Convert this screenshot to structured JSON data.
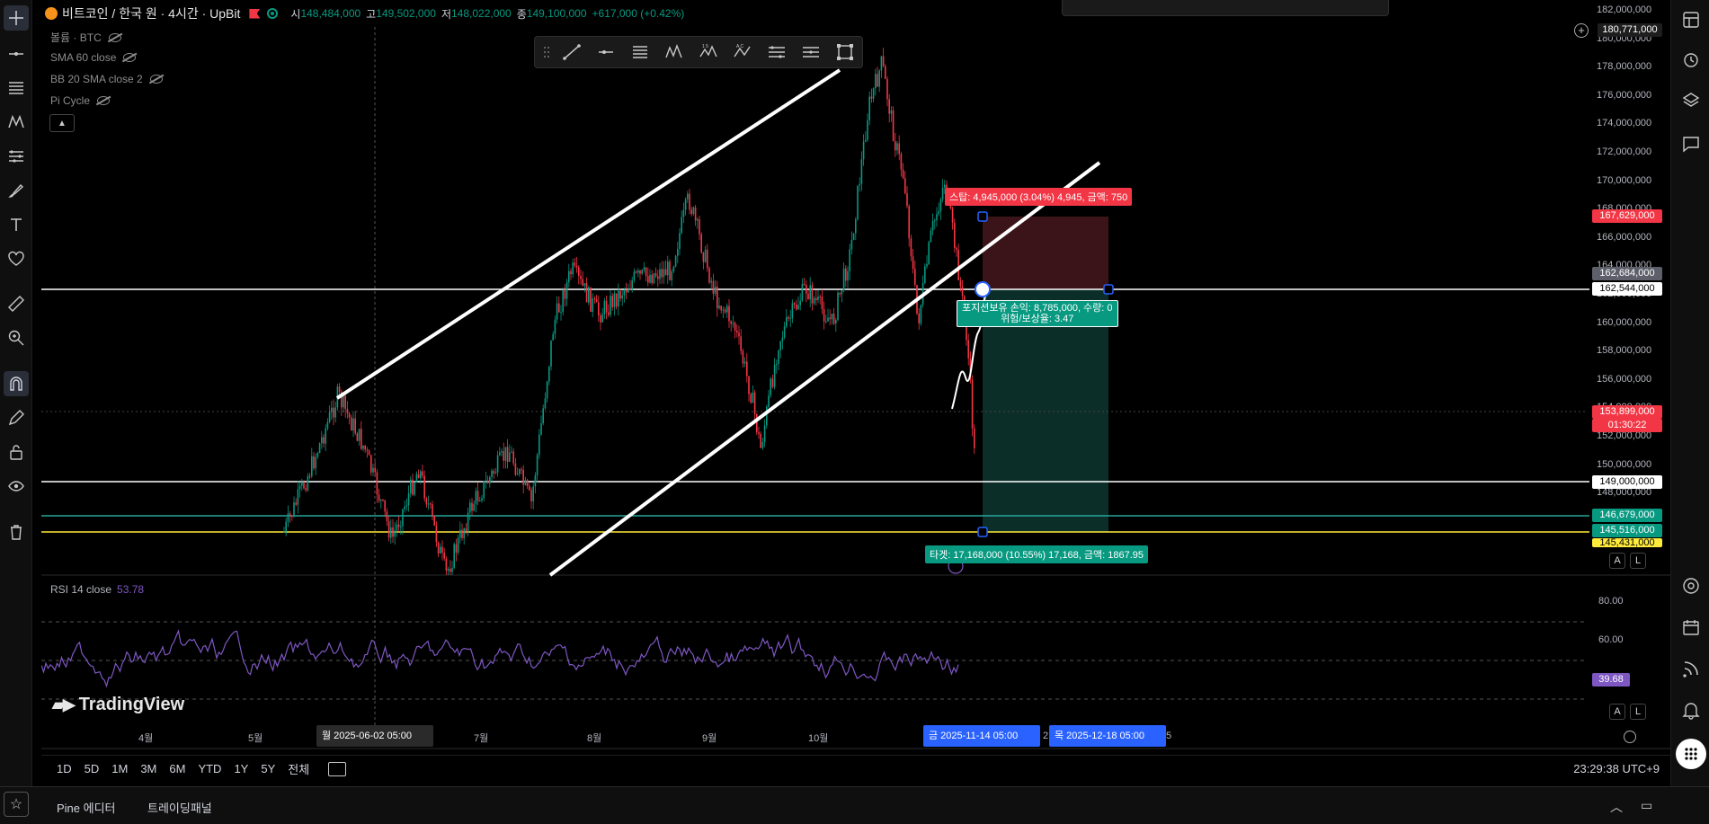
{
  "symbol": {
    "title": "비트코인 / 한국 원 · 4시간 · UpBit",
    "open_label": "시",
    "open": "148,484,000",
    "high_label": "고",
    "high": "149,502,000",
    "low_label": "저",
    "low": "148,022,000",
    "close_label": "종",
    "close": "149,100,000",
    "change": "+617,000 (+0.42%)"
  },
  "indicators": {
    "volume": "볼륨 · BTC",
    "sma": "SMA 60 close",
    "bb": "BB 20 SMA close 2",
    "pi": "Pi Cycle"
  },
  "price_axis": {
    "ticks": [
      "182,000,000",
      "180,000,000",
      "178,000,000",
      "176,000,000",
      "174,000,000",
      "172,000,000",
      "170,000,000",
      "168,000,000",
      "166,000,000",
      "164,000,000",
      "162,000,000",
      "160,000,000",
      "158,000,000",
      "156,000,000",
      "154,000,000",
      "152,000,000",
      "150,000,000",
      "148,000,000"
    ],
    "crosshair_price": "180,771,000",
    "stop_price": "167,629,000",
    "entry_upper": "162,684,000",
    "entry_price": "162,544,000",
    "last_price": "153,899,000",
    "countdown": "01:30:22",
    "h_line_1": "149,000,000",
    "h_line_2": "146,679,000",
    "h_line_3": "145,516,000",
    "h_line_4": "145,431,000"
  },
  "position_tool": {
    "stop_label": "스탑: 4,945,000 (3.04%) 4,945, 금액: 750",
    "info_line1": "포지션보유 손익: 8,785,000, 수량: 0",
    "info_line2": "위험/보상율: 3.47",
    "target_label": "타겟: 17,168,000 (10.55%) 17,168, 금액: 1867.95"
  },
  "rsi": {
    "title": "RSI 14 close",
    "value": "53.78",
    "ticks": [
      "80.00",
      "60.00"
    ],
    "current_badge": "39.68"
  },
  "time_axis": {
    "months": [
      "4월",
      "5월",
      "7월",
      "8월",
      "9월",
      "10월"
    ],
    "crosshair_date": "월 2025-06-02   05:00",
    "range_start": "금 2025-11-14   05:00",
    "range_end": "목 2025-12-18   05:00",
    "range_partial_left": "2",
    "range_partial_right": "5"
  },
  "bottom_bar": {
    "ranges": [
      "1D",
      "5D",
      "1M",
      "3M",
      "6M",
      "YTD",
      "1Y",
      "5Y",
      "전체"
    ],
    "clock": "23:29:38 UTC+9"
  },
  "footer": {
    "pine": "Pine 에디터",
    "trading": "트레이딩패널"
  },
  "watermark": "TradingView",
  "auto_label": "A",
  "log_label": "L",
  "colors": {
    "up": "#089981",
    "down": "#f23645",
    "rsi": "#7e57c2",
    "stop_zone": "#3a1418",
    "target_zone": "#0c2e29"
  }
}
